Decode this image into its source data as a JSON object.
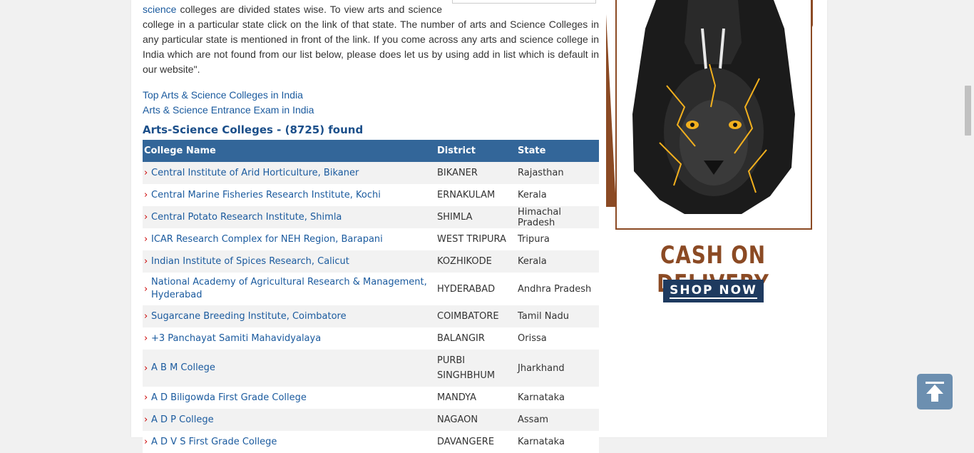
{
  "intro": {
    "link_word": "science",
    "text_after_link": " colleges are divided states wise. To view arts and science college in a particular state click on the link of that state. The number of arts and Science Colleges in any particular state is mentioned in front of the link. If you come across any arts and science college in India which are not found from our list below, please does let us by using add in list which is default in our website\"."
  },
  "links": [
    "Top Arts & Science Colleges in India",
    "Arts & Science Entrance Exam in India"
  ],
  "found_heading": "Arts-Science Colleges - (8725) found",
  "table": {
    "headers": {
      "name": "College Name",
      "district": "District",
      "state": "State"
    },
    "rows": [
      {
        "name": "Central Institute of Arid Horticulture, Bikaner",
        "district": "BIKANER",
        "state": "Rajasthan"
      },
      {
        "name": "Central Marine Fisheries Research Institute, Kochi",
        "district": "ERNAKULAM",
        "state": "Kerala"
      },
      {
        "name": "Central Potato Research Institute, Shimla",
        "district": "SHIMLA",
        "state": "Himachal Pradesh"
      },
      {
        "name": "ICAR Research Complex for NEH Region, Barapani",
        "district": "WEST TRIPURA",
        "state": "Tripura"
      },
      {
        "name": "Indian Institute of Spices Research, Calicut",
        "district": "KOZHIKODE",
        "state": "Kerala"
      },
      {
        "name": "National Academy of Agricultural Research & Management, Hyderabad",
        "district": "HYDERABAD",
        "state": "Andhra Pradesh"
      },
      {
        "name": "Sugarcane Breeding Institute, Coimbatore",
        "district": "COIMBATORE",
        "state": "Tamil Nadu"
      },
      {
        "name": "+3 Panchayat Samiti Mahavidyalaya",
        "district": "BALANGIR",
        "state": "Orissa"
      },
      {
        "name": "A B M College",
        "district": "PURBI SINGHBHUM",
        "state": "Jharkhand"
      },
      {
        "name": "A D Biligowda First Grade College",
        "district": "MANDYA",
        "state": "Karnataka"
      },
      {
        "name": "A D P College",
        "district": "NAGAON",
        "state": "Assam"
      },
      {
        "name": "A D V S First Grade College",
        "district": "DAVANGERE",
        "state": "Karnataka"
      }
    ]
  },
  "ad": {
    "cod_text": "CASH ON DELIVERY",
    "shop_label": "SHOP NOW",
    "brand_color": "#8b4a24",
    "button_color": "#1e3a5f"
  },
  "icons": {
    "back_to_top": "arrow-up-icon",
    "row_bullet": "chevron-right-icon"
  }
}
